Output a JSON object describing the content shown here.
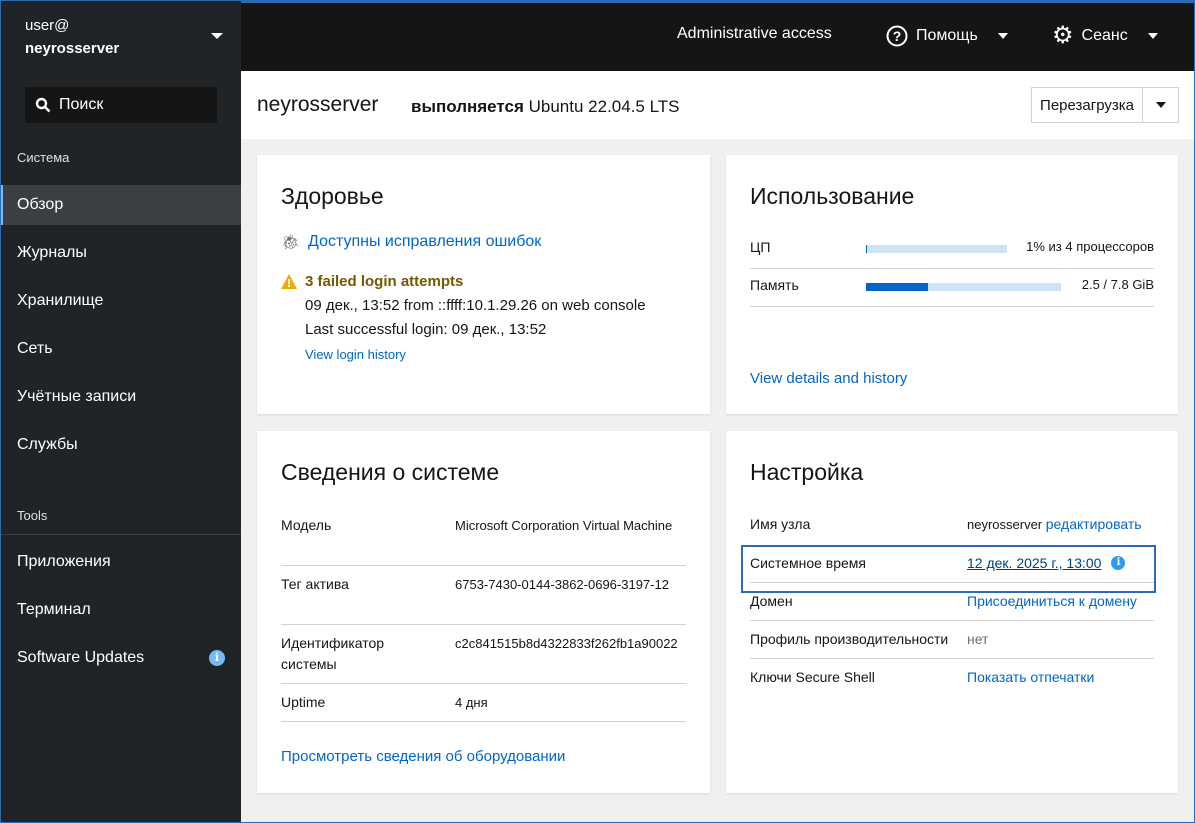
{
  "sidebar": {
    "user": "user@",
    "host": "neyrosserver",
    "search": "Поиск",
    "section_system": "Система",
    "items": [
      {
        "label": "Обзор"
      },
      {
        "label": "Журналы"
      },
      {
        "label": "Хранилище"
      },
      {
        "label": "Сеть"
      },
      {
        "label": "Учётные записи"
      },
      {
        "label": "Службы"
      }
    ],
    "section_tools": "Tools",
    "tools": [
      {
        "label": "Приложения"
      },
      {
        "label": "Терминал"
      },
      {
        "label": "Software Updates"
      }
    ]
  },
  "topbar": {
    "admin": "Administrative access",
    "help": "Помощь",
    "session": "Сеанс"
  },
  "header": {
    "host": "neyrosserver",
    "running_prefix": "выполняется",
    "os": "Ubuntu 22.04.5 LTS",
    "reboot": "Перезагрузка"
  },
  "health": {
    "title": "Здоровье",
    "updates": "Доступны исправления ошибок",
    "failed": "3 failed login attempts",
    "failed_detail": "09 дек., 13:52 from ::ffff:10.1.29.26 on web console",
    "last_login": "Last successful login: 09 дек., 13:52",
    "history": "View login history"
  },
  "usage": {
    "title": "Использование",
    "cpu_label": "ЦП",
    "cpu_value": "1% из 4 процессоров",
    "cpu_percent": 1,
    "mem_label": "Память",
    "mem_value": "2.5 / 7.8 GiB",
    "mem_percent": 32,
    "details": "View details and history"
  },
  "sysinfo": {
    "title": "Сведения о системе",
    "rows": [
      {
        "label": "Модель",
        "value": "Microsoft Corporation Virtual Machine"
      },
      {
        "label": "Тег актива",
        "value": "6753-7430-0144-3862-0696-3197-12"
      },
      {
        "label": "Идентификатор системы",
        "value": "c2c841515b8d4322833f262fb1a90022"
      },
      {
        "label": "Uptime",
        "value": "4 дня"
      }
    ],
    "hardware": "Просмотреть сведения об оборудовании"
  },
  "config": {
    "title": "Настройка",
    "hostname_label": "Имя узла",
    "hostname": "neyrosserver",
    "edit": "редактировать",
    "time_label": "Системное время",
    "time": "12 дек. 2025 г., 13:00",
    "domain_label": "Домен",
    "domain": "Присоединиться к домену",
    "profile_label": "Профиль производительности",
    "profile": "нет",
    "ssh_label": "Ключи Secure Shell",
    "ssh": "Показать отпечатки"
  }
}
